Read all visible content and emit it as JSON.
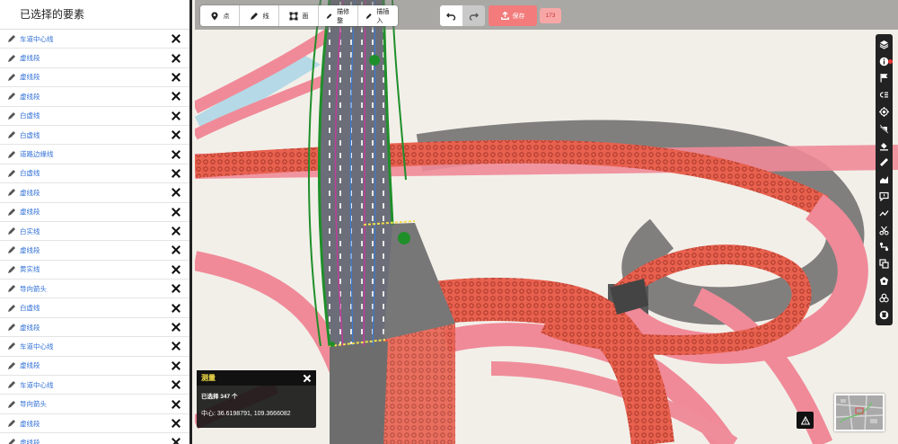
{
  "sidebar": {
    "title": "已选择的要素",
    "items": [
      {
        "label": "车道中心线"
      },
      {
        "label": "虚线段"
      },
      {
        "label": "虚线段"
      },
      {
        "label": "虚线段"
      },
      {
        "label": "白虚线"
      },
      {
        "label": "白虚线"
      },
      {
        "label": "道路边缘线"
      },
      {
        "label": "白虚线"
      },
      {
        "label": "虚线段"
      },
      {
        "label": "虚线段"
      },
      {
        "label": "白实线"
      },
      {
        "label": "虚线段"
      },
      {
        "label": "黄实线"
      },
      {
        "label": "导向箭头"
      },
      {
        "label": "白虚线"
      },
      {
        "label": "虚线段"
      },
      {
        "label": "车道中心线"
      },
      {
        "label": "虚线段"
      },
      {
        "label": "车道中心线"
      },
      {
        "label": "导向箭头"
      },
      {
        "label": "虚线段"
      },
      {
        "label": "虚线段"
      }
    ]
  },
  "toolbar": {
    "tools": [
      {
        "label": "点",
        "icon": "map-pin-icon"
      },
      {
        "label": "线",
        "icon": "pencil-icon"
      },
      {
        "label": "面",
        "icon": "polygon-icon"
      },
      {
        "label": "描修整",
        "icon": "pencil-icon"
      },
      {
        "label": "描插入",
        "icon": "pencil-icon"
      }
    ],
    "save_label": "保存",
    "count": "173"
  },
  "measure": {
    "title": "测量",
    "selected": "已选择 347 个",
    "center": "中心: 36.6198791, 109.3666082"
  },
  "right_tools": [
    "layers-icon",
    "info-icon",
    "flag-icon",
    "list-icon",
    "locate-icon",
    "slash-visibility-icon",
    "paint-icon",
    "ruler-icon",
    "area-icon",
    "comment-icon",
    "line-chart-icon",
    "scissors-icon",
    "route-icon",
    "copy-icon",
    "polygon-icon",
    "circles-icon",
    "trash-icon"
  ],
  "colors": {
    "accent_red": "#f37b7b",
    "link_blue": "#2f6fd6",
    "road_pink": "#f08a98",
    "road_red": "#e85b4a",
    "selection_green": "#1f8f2a",
    "measure_yellow": "#f6e04a"
  }
}
